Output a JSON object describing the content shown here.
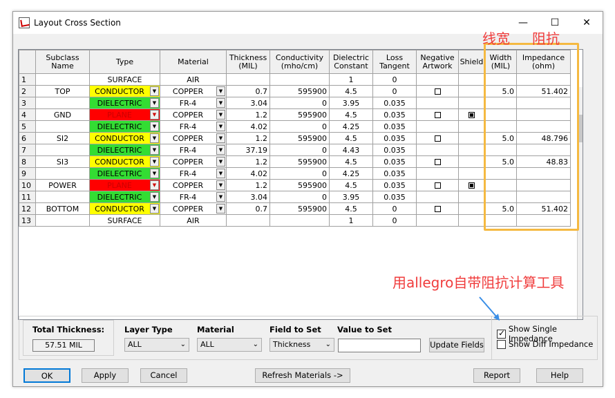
{
  "window": {
    "title": "Layout Cross Section",
    "minimize": "—",
    "maximize": "☐",
    "close": "✕"
  },
  "grid": {
    "columns": [
      "",
      "Subclass Name",
      "Type",
      "Material",
      "Thickness (MIL)",
      "Conductivity (mho/cm)",
      "Dielectric Constant",
      "Loss Tangent",
      "Negative Artwork",
      "Shield",
      "Width (MIL)",
      "Impedance (ohm)"
    ],
    "rows": [
      {
        "n": "1",
        "name": "",
        "type": "SURFACE",
        "type_kind": "surface",
        "material": "AIR",
        "thickness": "",
        "cond": "",
        "dk": "1",
        "loss": "0",
        "neg": "",
        "shield": "",
        "width": "",
        "imp": ""
      },
      {
        "n": "2",
        "name": "TOP",
        "type": "CONDUCTOR",
        "type_kind": "conductor",
        "material": "COPPER",
        "thickness": "0.7",
        "cond": "595900",
        "dk": "4.5",
        "loss": "0",
        "neg": "box",
        "shield": "",
        "width": "5.0",
        "imp": "51.402"
      },
      {
        "n": "3",
        "name": "",
        "type": "DIELECTRIC",
        "type_kind": "dielectric",
        "material": "FR-4",
        "thickness": "3.04",
        "cond": "0",
        "dk": "3.95",
        "loss": "0.035",
        "neg": "",
        "shield": "",
        "width": "",
        "imp": ""
      },
      {
        "n": "4",
        "name": "GND",
        "type": "PLANE",
        "type_kind": "plane",
        "material": "COPPER",
        "thickness": "1.2",
        "cond": "595900",
        "dk": "4.5",
        "loss": "0.035",
        "neg": "box",
        "shield": "checked",
        "width": "",
        "imp": ""
      },
      {
        "n": "5",
        "name": "",
        "type": "DIELECTRIC",
        "type_kind": "dielectric",
        "material": "FR-4",
        "thickness": "4.02",
        "cond": "0",
        "dk": "4.25",
        "loss": "0.035",
        "neg": "",
        "shield": "",
        "width": "",
        "imp": ""
      },
      {
        "n": "6",
        "name": "SI2",
        "type": "CONDUCTOR",
        "type_kind": "conductor",
        "material": "COPPER",
        "thickness": "1.2",
        "cond": "595900",
        "dk": "4.5",
        "loss": "0.035",
        "neg": "box",
        "shield": "",
        "width": "5.0",
        "imp": "48.796"
      },
      {
        "n": "7",
        "name": "",
        "type": "DIELECTRIC",
        "type_kind": "dielectric",
        "material": "FR-4",
        "thickness": "37.19",
        "cond": "0",
        "dk": "4.43",
        "loss": "0.035",
        "neg": "",
        "shield": "",
        "width": "",
        "imp": ""
      },
      {
        "n": "8",
        "name": "SI3",
        "type": "CONDUCTOR",
        "type_kind": "conductor",
        "material": "COPPER",
        "thickness": "1.2",
        "cond": "595900",
        "dk": "4.5",
        "loss": "0.035",
        "neg": "box",
        "shield": "",
        "width": "5.0",
        "imp": "48.83"
      },
      {
        "n": "9",
        "name": "",
        "type": "DIELECTRIC",
        "type_kind": "dielectric",
        "material": "FR-4",
        "thickness": "4.02",
        "cond": "0",
        "dk": "4.25",
        "loss": "0.035",
        "neg": "",
        "shield": "",
        "width": "",
        "imp": ""
      },
      {
        "n": "10",
        "name": "POWER",
        "type": "PLANE",
        "type_kind": "plane",
        "material": "COPPER",
        "thickness": "1.2",
        "cond": "595900",
        "dk": "4.5",
        "loss": "0.035",
        "neg": "box",
        "shield": "checked",
        "width": "",
        "imp": ""
      },
      {
        "n": "11",
        "name": "",
        "type": "DIELECTRIC",
        "type_kind": "dielectric",
        "material": "FR-4",
        "thickness": "3.04",
        "cond": "0",
        "dk": "3.95",
        "loss": "0.035",
        "neg": "",
        "shield": "",
        "width": "",
        "imp": ""
      },
      {
        "n": "12",
        "name": "BOTTOM",
        "type": "CONDUCTOR",
        "type_kind": "conductor",
        "material": "COPPER",
        "thickness": "0.7",
        "cond": "595900",
        "dk": "4.5",
        "loss": "0",
        "neg": "box",
        "shield": "",
        "width": "5.0",
        "imp": "51.402"
      },
      {
        "n": "13",
        "name": "",
        "type": "SURFACE",
        "type_kind": "surface",
        "material": "AIR",
        "thickness": "",
        "cond": "",
        "dk": "1",
        "loss": "0",
        "neg": "",
        "shield": "",
        "width": "",
        "imp": ""
      }
    ]
  },
  "colors": {
    "conductor": "#ffff00",
    "dielectric": "#33dd33",
    "plane": "#ff0000",
    "plane_text": "#cc0000",
    "highlight": "#f5b941",
    "annotation": "#f03c3c",
    "arrow": "#3a8ee6"
  },
  "bottom": {
    "total_label": "Total Thickness:",
    "total_value": "57.51 MIL",
    "layer_type_label": "Layer Type",
    "layer_type_value": "ALL",
    "material_label": "Material",
    "material_value": "ALL",
    "field_label": "Field to Set",
    "field_value": "Thickness",
    "value_label": "Value to Set",
    "value_value": "",
    "update_button": "Update Fields",
    "show_single": "Show Single Impedance",
    "show_diff": "Show Diff Impedance"
  },
  "buttons": {
    "ok": "OK",
    "apply": "Apply",
    "cancel": "Cancel",
    "refresh": "Refresh Materials ->",
    "report": "Report",
    "help": "Help"
  },
  "annotations": {
    "width_note": "线宽",
    "impedance_note": "阻抗",
    "tool_note": "用allegro自带阻抗计算工具"
  }
}
